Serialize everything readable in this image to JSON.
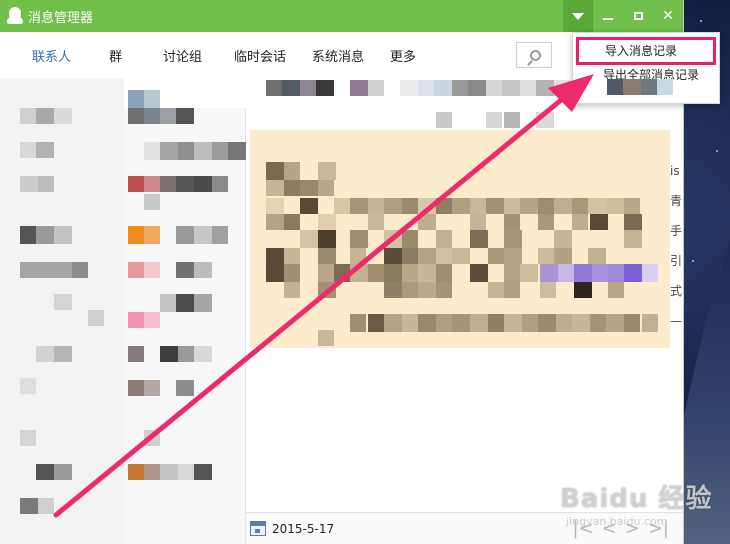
{
  "window": {
    "title": "消息管理器"
  },
  "tabs": [
    {
      "label": "联系人",
      "active": true
    },
    {
      "label": "群",
      "active": false
    },
    {
      "label": "讨论组",
      "active": false
    },
    {
      "label": "临时会话",
      "active": false
    },
    {
      "label": "系统消息",
      "active": false
    },
    {
      "label": "更多",
      "active": false
    }
  ],
  "dropdown": {
    "items": [
      {
        "label": "导入消息记录"
      },
      {
        "label": "导出全部消息记录"
      }
    ]
  },
  "chat": {
    "side_text": "is 青 手 引 式 —"
  },
  "bottombar": {
    "date": "2015-5-17",
    "pager": [
      "|<",
      "<",
      ">",
      ">|"
    ]
  },
  "watermark": {
    "main": "Baidu 经验",
    "sub": "jingyan.baidu.com"
  },
  "colors": {
    "titlebar": "#6fbf4a",
    "active_tab": "#2f6fb5",
    "highlight": "#e8215f",
    "arrow": "#ee2a6a",
    "message_bg": "#fdeccb"
  }
}
